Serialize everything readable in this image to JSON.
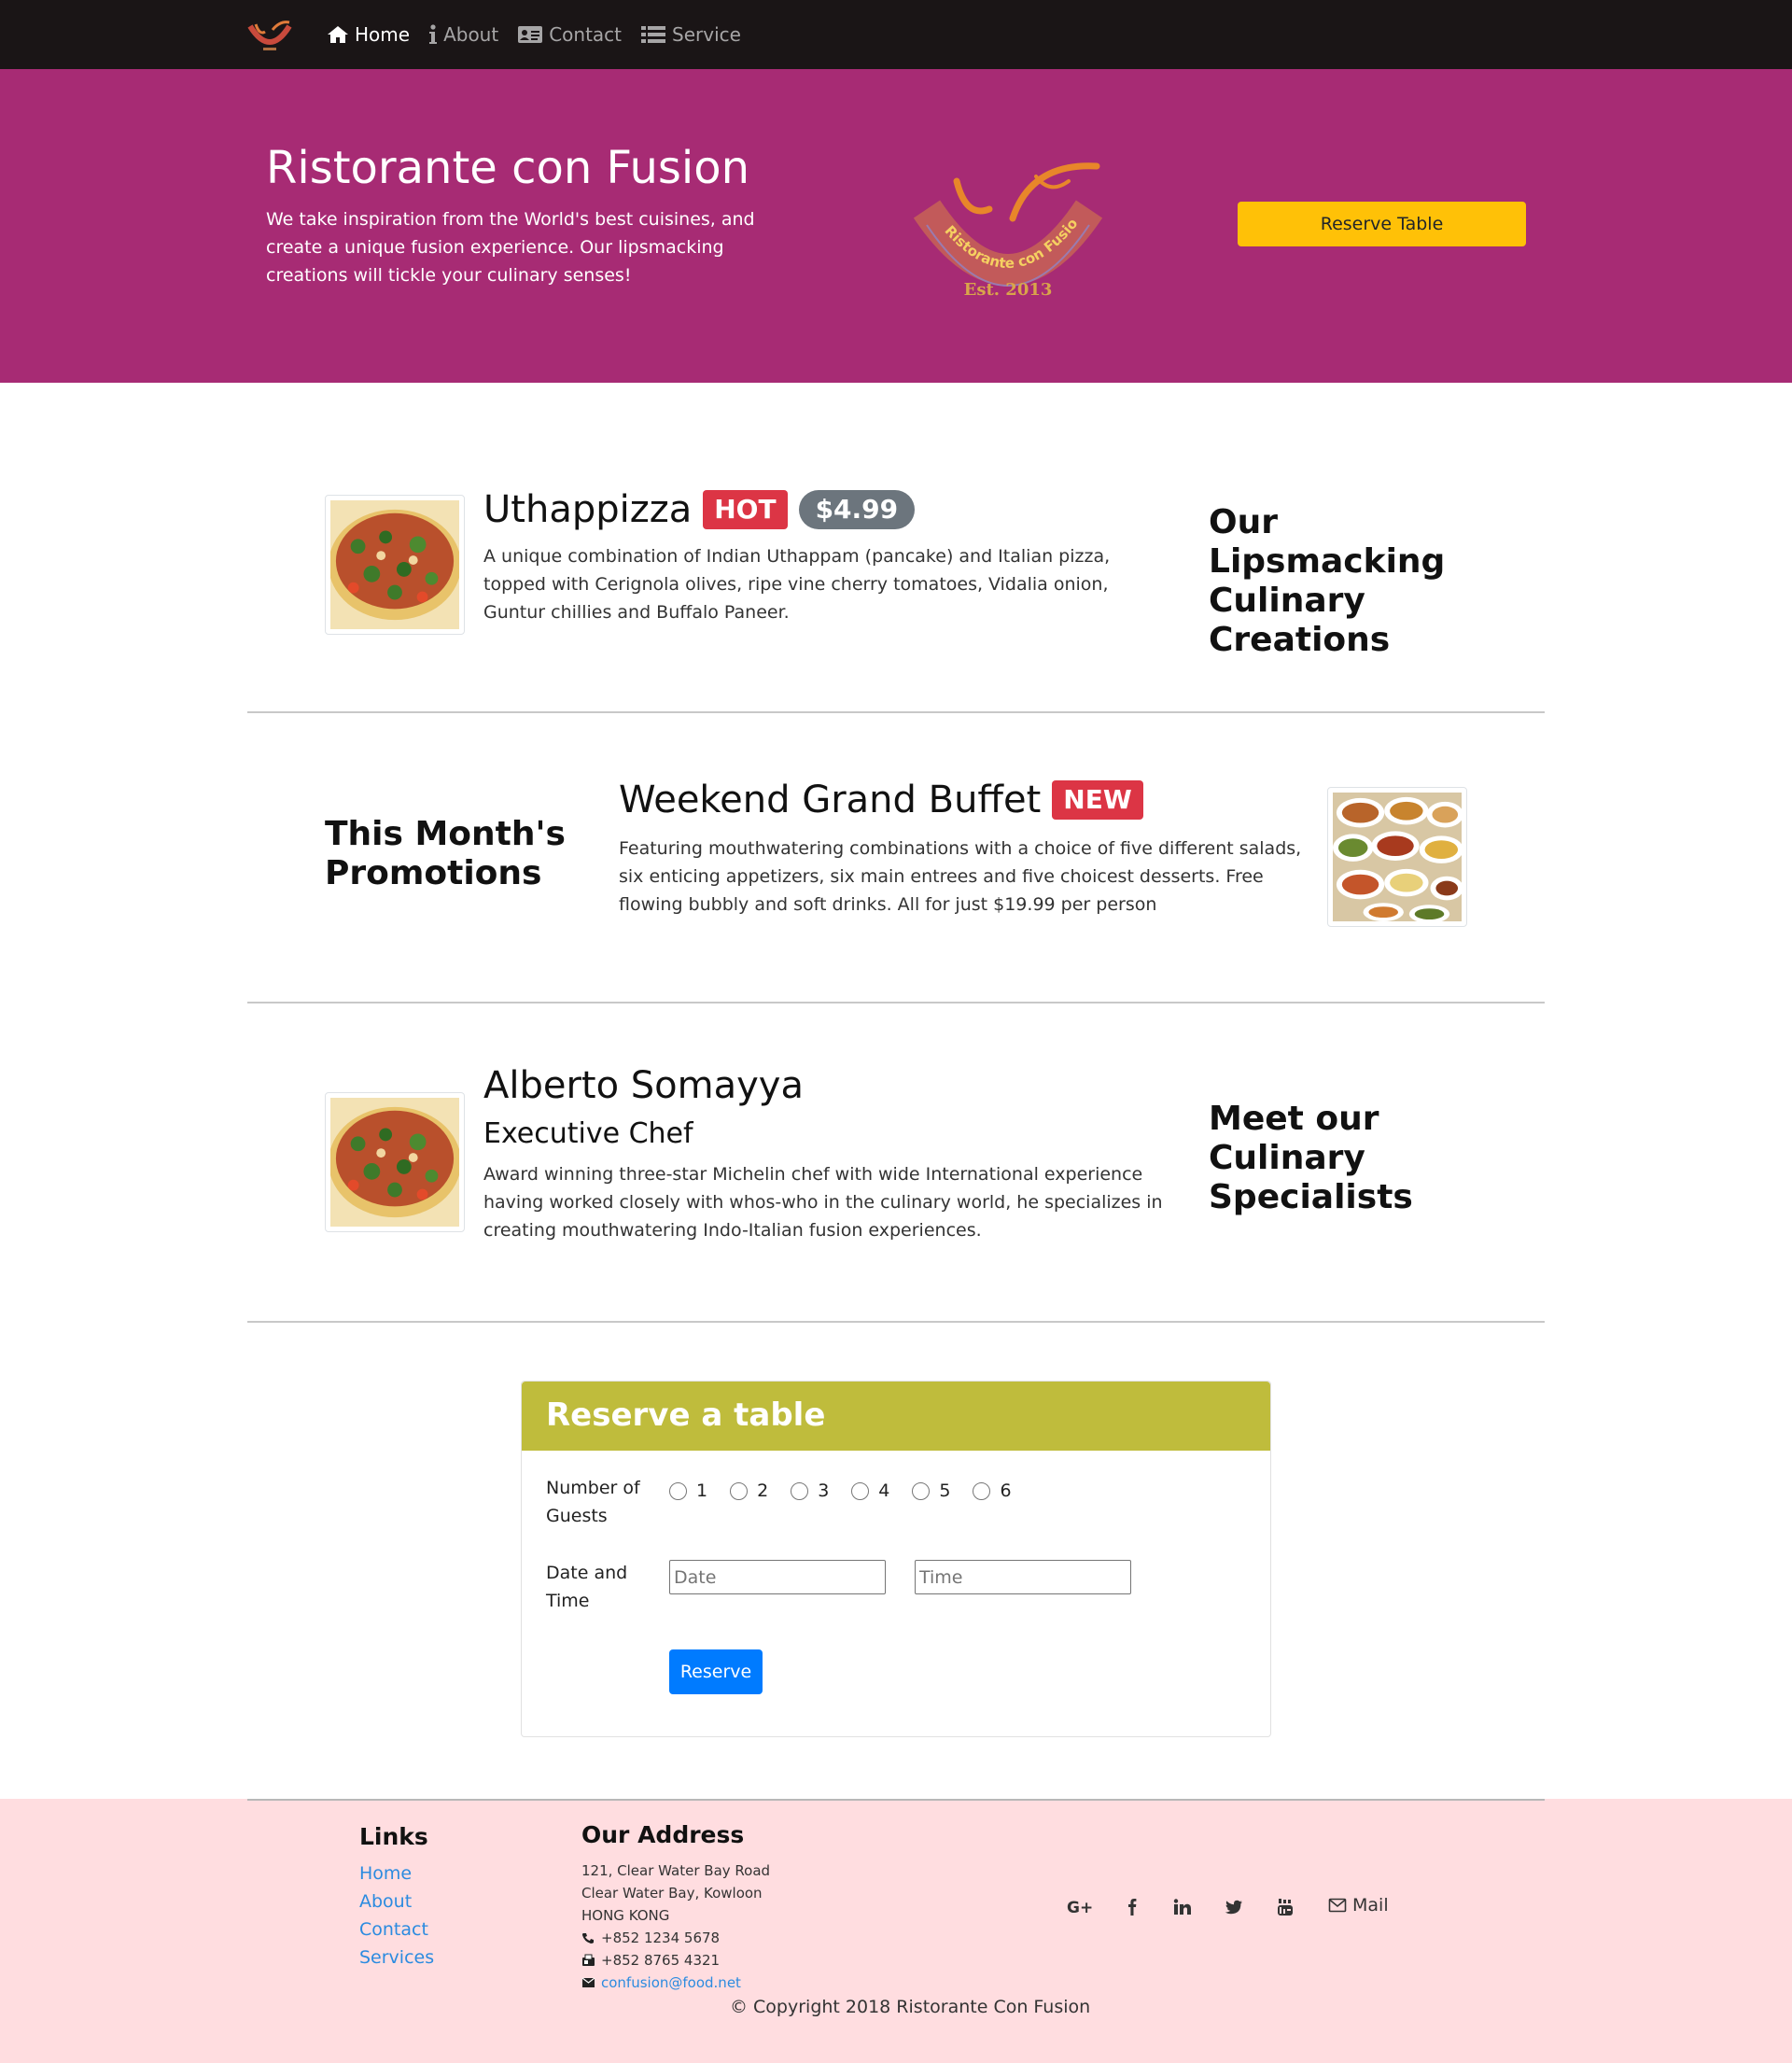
{
  "navbar": {
    "links": [
      {
        "label": "Home",
        "icon": "home-icon"
      },
      {
        "label": "About",
        "icon": "info-icon"
      },
      {
        "label": "Contact",
        "icon": "address-card-icon"
      },
      {
        "label": "Service",
        "icon": "list-icon"
      }
    ]
  },
  "jumbotron": {
    "title": "Ristorante con Fusion",
    "text": "We take inspiration from the World's best cuisines, and create a unique fusion experience. Our lipsmacking creations will tickle your culinary senses!",
    "logo": {
      "name_text": "Ristorante con Fusion",
      "est_text": "Est. 2013"
    },
    "reserve_button": "Reserve Table"
  },
  "dish": {
    "title": "Uthappizza",
    "badge": "HOT",
    "price": "$4.99",
    "description": "A unique combination of Indian Uthappam (pancake) and Italian pizza, topped with Cerignola olives, ripe vine cherry tomatoes, Vidalia onion, Guntur chillies and Buffalo Paneer.",
    "side_heading": "Our Lipsmacking Culinary Creations"
  },
  "promotion": {
    "side_heading": "This Month's Promotions",
    "title": "Weekend Grand Buffet",
    "badge": "NEW",
    "description": "Featuring mouthwatering combinations with a choice of five different salads, six enticing appetizers, six main entrees and five choicest desserts. Free flowing bubbly and soft drinks. All for just $19.99 per person"
  },
  "leader": {
    "name": "Alberto Somayya",
    "designation": "Executive Chef",
    "description": "Award winning three-star Michelin chef with wide International experience having worked closely with whos-who in the culinary world, he specializes in creating mouthwatering Indo-Italian fusion experiences.",
    "side_heading": "Meet our Culinary Specialists"
  },
  "reservation": {
    "title": "Reserve a table",
    "guests_label": "Number of Guests",
    "guest_options": [
      "1",
      "2",
      "3",
      "4",
      "5",
      "6"
    ],
    "datetime_label": "Date and Time",
    "date_placeholder": "Date",
    "time_placeholder": "Time",
    "submit": "Reserve"
  },
  "footer": {
    "links_heading": "Links",
    "links": [
      "Home",
      "About",
      "Contact",
      "Services"
    ],
    "address_heading": "Our Address",
    "address_lines": [
      "121, Clear Water Bay Road",
      "Clear Water Bay, Kowloon",
      "HONG KONG"
    ],
    "phone": "+852 1234 5678",
    "fax": "+852 8765 4321",
    "email": "confusion@food.net",
    "social": [
      "google-plus-icon",
      "facebook-icon",
      "linkedin-icon",
      "twitter-icon",
      "youtube-icon"
    ],
    "mail_label": "Mail",
    "copyright": "© Copyright 2018 Ristorante Con Fusion"
  },
  "colors": {
    "navbar": "#1a1516",
    "jumbotron": "#a72b74",
    "reserve_button": "#ffc107",
    "card_header": "#bfbc3c",
    "primary": "#007bff",
    "badge_danger": "#dc3545",
    "badge_price": "#6c757d",
    "footer": "#ffdde0"
  }
}
